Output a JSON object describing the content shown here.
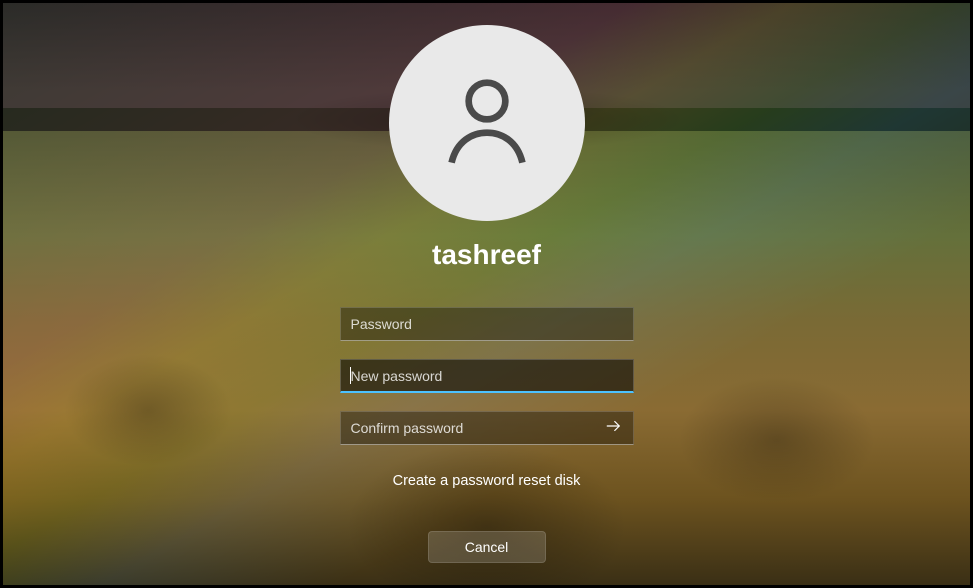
{
  "user": {
    "name": "tashreef"
  },
  "fields": {
    "password": {
      "placeholder": "Password",
      "value": ""
    },
    "new_password": {
      "placeholder": "New password",
      "value": ""
    },
    "confirm_password": {
      "placeholder": "Confirm password",
      "value": ""
    }
  },
  "links": {
    "reset_disk": "Create a password reset disk"
  },
  "buttons": {
    "cancel": "Cancel"
  },
  "icons": {
    "avatar": "user-icon",
    "submit": "arrow-right-icon"
  },
  "colors": {
    "focus_accent": "#4cc2ff"
  }
}
